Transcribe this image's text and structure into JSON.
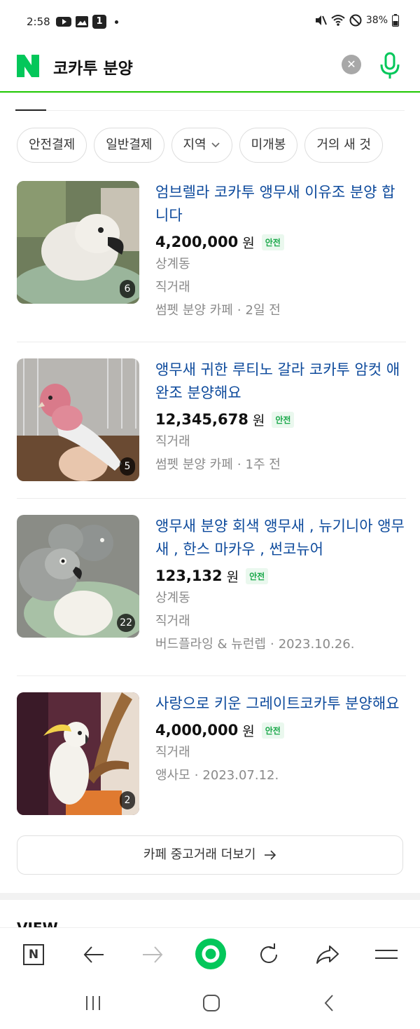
{
  "status_bar": {
    "time": "2:58",
    "notification_count": "1",
    "battery": "38%"
  },
  "search": {
    "query": "코카투 분양"
  },
  "filters": [
    "안전결제",
    "일반결제",
    "지역",
    "미개봉",
    "거의 새 것"
  ],
  "listings": [
    {
      "title": "엄브렐라 코카투 앵무새 이유조 분양 합니다",
      "price": "4,200,000",
      "currency": "원",
      "badge": "안전",
      "meta_lines": [
        "상계동",
        "직거래"
      ],
      "source": "썸펫 분양 카페",
      "date": "2일 전",
      "photo_count": "6"
    },
    {
      "title": "앵무새 귀한 루티노 갈라 코카투 암컷 애완조 분양해요",
      "price": "12,345,678",
      "currency": "원",
      "badge": "안전",
      "meta_lines": [
        "직거래"
      ],
      "source": "썸펫 분양 카페",
      "date": "1주 전",
      "photo_count": "5"
    },
    {
      "title": "앵무새 분양 회색 앵무새 , 뉴기니아 앵무새 , 한스 마카우 , 썬코뉴어",
      "price": "123,132",
      "currency": "원",
      "badge": "안전",
      "meta_lines": [
        "상계동",
        "직거래"
      ],
      "source": "버드플라잉 & 뉴런렙",
      "date": "2023.10.26.",
      "photo_count": "22"
    },
    {
      "title": "사랑으로 키운 그레이트코카투 분양해요",
      "price": "4,000,000",
      "currency": "원",
      "badge": "안전",
      "meta_lines": [
        "직거래"
      ],
      "source": "앵사모",
      "date": "2023.07.12.",
      "photo_count": "2"
    }
  ],
  "more_button": "카페 중고거래 더보기",
  "next_section": "VIEW",
  "toolbar": {
    "home_label": "N"
  },
  "colors": {
    "naver_green": "#03c75a",
    "link_blue": "#0d4a9c",
    "safe_green": "#1aa84a"
  }
}
